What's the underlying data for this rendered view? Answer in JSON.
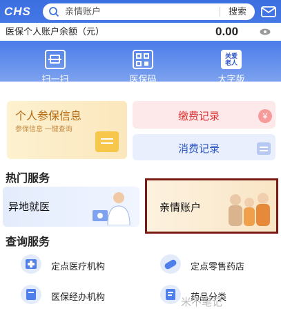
{
  "header": {
    "logo": "CHS",
    "search_placeholder": "亲情账户",
    "search_button": "搜索"
  },
  "balance": {
    "label": "医保个人账户余额（元）",
    "amount": "0.00"
  },
  "quick_actions": [
    {
      "label": "扫一扫",
      "icon": "scan-icon"
    },
    {
      "label": "医保码",
      "icon": "qr-code-icon"
    },
    {
      "label": "大字版",
      "icon": "elderly-care-icon",
      "icon_text_top": "关爱",
      "icon_text_bottom": "老人"
    }
  ],
  "cards": {
    "insurance": {
      "title": "个人参保信息",
      "subtitle": "参保信息 一键查询"
    },
    "payment": {
      "title": "缴费记录",
      "icon_char": "¥"
    },
    "consumption": {
      "title": "消费记录"
    }
  },
  "hot_services": {
    "title": "热门服务",
    "items": [
      {
        "label": "异地就医"
      },
      {
        "label": "亲情账户"
      }
    ]
  },
  "query_services": {
    "title": "查询服务",
    "items": [
      {
        "label": "定点医疗机构",
        "icon": "hospital-icon"
      },
      {
        "label": "定点零售药店",
        "icon": "pill-icon"
      },
      {
        "label": "医保经办机构",
        "icon": "office-icon"
      },
      {
        "label": "药品分类",
        "icon": "list-icon"
      }
    ]
  },
  "watermark": "米不笔记"
}
